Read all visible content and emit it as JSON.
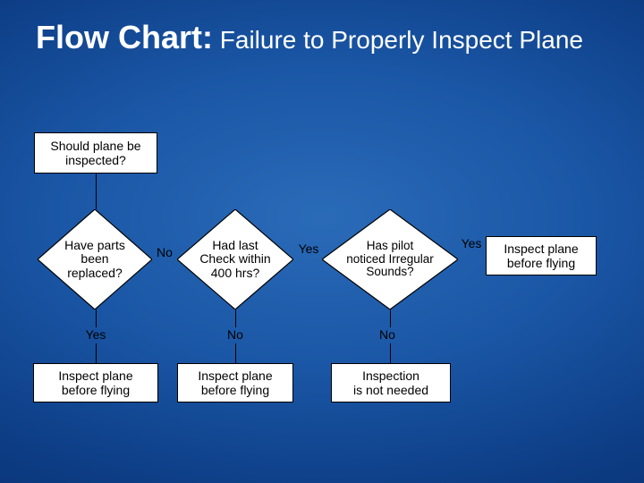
{
  "title": {
    "bold": "Flow Chart:",
    "rest": " Failure to Properly Inspect Plane"
  },
  "nodes": {
    "start": {
      "text": "Should plane be\ninspected?"
    },
    "parts": {
      "text": "Have parts\nbeen\nreplaced?"
    },
    "lastcheck": {
      "text": "Had last\nCheck within\n400 hrs?"
    },
    "sounds": {
      "text": "Has pilot\nnoticed Irregular\nSounds?"
    },
    "inspectR": {
      "text": "Inspect plane\nbefore flying"
    },
    "inspectL": {
      "text": "Inspect plane\nbefore flying"
    },
    "inspectM": {
      "text": "Inspect plane\nbefore flying"
    },
    "noneed": {
      "text": "Inspection\nis not needed"
    }
  },
  "labels": {
    "parts_no": "No",
    "parts_yes": "Yes",
    "lastcheck_yes": "Yes",
    "lastcheck_no": "No",
    "sounds_yes": "Yes",
    "sounds_no": "No"
  }
}
